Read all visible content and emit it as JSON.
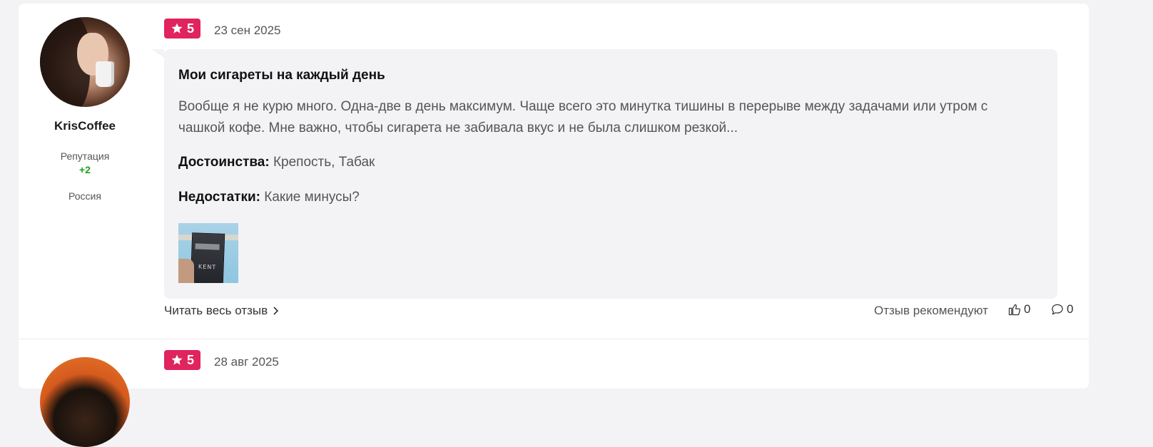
{
  "reviews": [
    {
      "author": {
        "name": "KrisCoffee",
        "reputation_label": "Репутация",
        "reputation_value": "+2",
        "country": "Россия"
      },
      "rating": "5",
      "date": "23 сен 2025",
      "title": "Мои сигареты на каждый день",
      "text": "Вообще я не курю много. Одна-две в день максимум. Чаще всего это минутка тишины в перерыве между задачами или утром с чашкой кофе. Мне важно, чтобы сигарета не забивала вкус и не была слишком резкой...",
      "pros_label": "Достоинства:",
      "pros": "Крепость, Табак",
      "cons_label": "Недостатки:",
      "cons": "Какие минусы?",
      "photo_brand": "KENT",
      "read_more": "Читать весь отзыв",
      "recommend_label": "Отзыв рекомендуют",
      "likes": "0",
      "comments": "0"
    },
    {
      "rating": "5",
      "date": "28 авг 2025"
    }
  ],
  "colors": {
    "rating_badge": "#e0245e",
    "reputation_positive": "#1aa31a",
    "bubble_bg": "#f3f3f5"
  },
  "icons": [
    "star-icon",
    "chevron-right-icon",
    "thumbs-up-icon",
    "comment-icon"
  ]
}
